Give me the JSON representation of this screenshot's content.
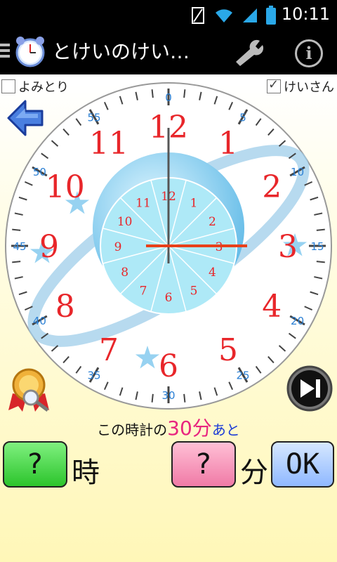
{
  "status": {
    "time": "10:11"
  },
  "appbar": {
    "title": "とけいのけい…"
  },
  "options": {
    "yomitori_label": "よみとり",
    "keisan_label": "けいさん",
    "yomitori_checked": false,
    "keisan_checked": true
  },
  "clock": {
    "hour_numbers": [
      "12",
      "1",
      "2",
      "3",
      "4",
      "5",
      "6",
      "7",
      "8",
      "9",
      "10",
      "11"
    ],
    "minute_labels": [
      "0",
      "5",
      "10",
      "15",
      "20",
      "25",
      "30",
      "35",
      "40",
      "45",
      "50",
      "55"
    ],
    "inner_numbers": [
      "12",
      "1",
      "2",
      "3",
      "4",
      "5",
      "6",
      "7",
      "8",
      "9",
      "10",
      "11"
    ],
    "hour_hand_hour": 3,
    "minute_hand_minute": 0,
    "colors": {
      "hour_red": "#e8262a",
      "minute_blue": "#2a7fd4",
      "hand": "#e8401a",
      "inner_bg": "#aee9f7"
    }
  },
  "hint": {
    "prefix": "この時計の",
    "value": "30分",
    "suffix": "あと"
  },
  "answer": {
    "hour_value": "?",
    "hour_unit": "時",
    "minute_value": "?",
    "minute_unit": "分",
    "ok_label": "OK"
  }
}
